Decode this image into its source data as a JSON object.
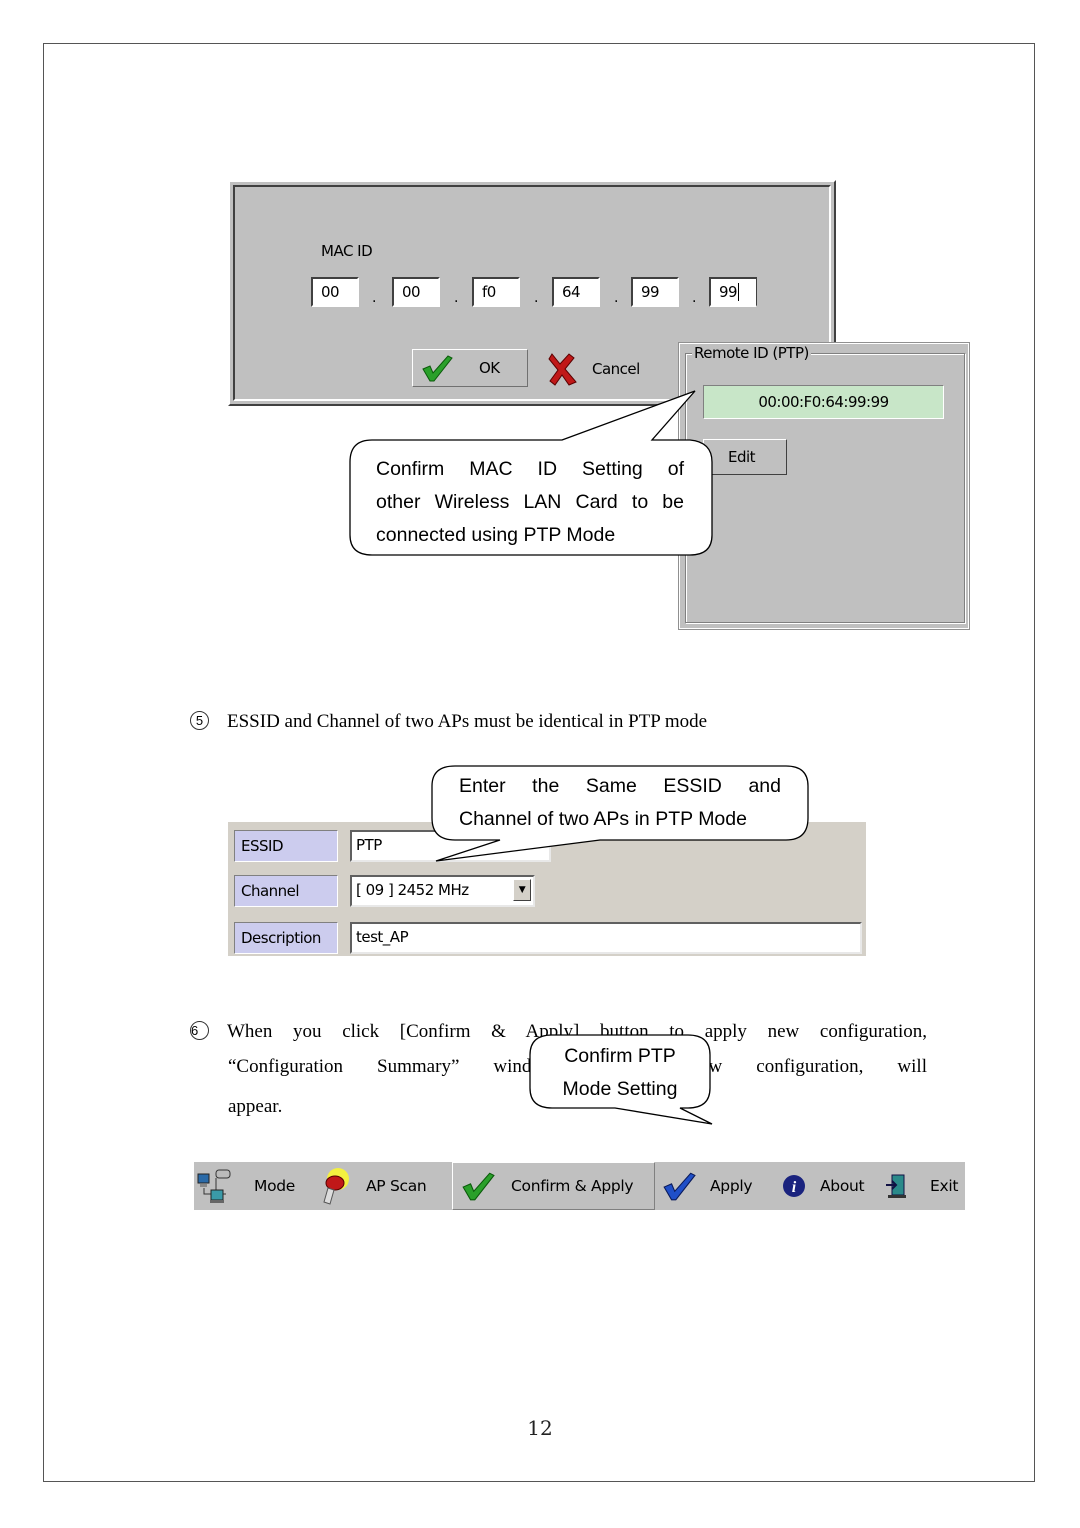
{
  "mac_dialog": {
    "label": "MAC ID",
    "octets": [
      "00",
      "00",
      "f0",
      "64",
      "99",
      "99"
    ],
    "separator": ".",
    "ok_label": "OK",
    "cancel_label": "Cancel"
  },
  "remote_panel": {
    "title": "Remote ID (PTP)",
    "value": "00:00:F0:64:99:99",
    "edit_label": "Edit"
  },
  "callouts": {
    "mac_confirm": {
      "lines": [
        "Confirm MAC ID Setting of",
        "other Wireless LAN Card to be",
        "connected using PTP Mode"
      ]
    },
    "essid_same": {
      "lines": [
        "Enter the Same ESSID and",
        "Channel of two APs in PTP Mode"
      ]
    },
    "confirm_ptp": {
      "lines": [
        "Confirm PTP",
        "Mode Setting"
      ]
    }
  },
  "steps": {
    "step5": {
      "number": "5",
      "text": "ESSID and Channel of two APs must be identical in PTP mode"
    },
    "step6": {
      "number": "6",
      "line1": "When you click [Confirm & Apply] button to apply new configuration,",
      "line2": "“Configuration Summary” window, showing new configuration, will",
      "line3": "appear."
    }
  },
  "form": {
    "essid": {
      "label": "ESSID",
      "value": "PTP"
    },
    "channel": {
      "label": "Channel",
      "value": "[ 09 ] 2452 MHz"
    },
    "description": {
      "label": "Description",
      "value": "test_AP"
    }
  },
  "toolbar": {
    "items": [
      {
        "label": "Mode",
        "icon": "network-icon"
      },
      {
        "label": "AP Scan",
        "icon": "scan-torch-icon"
      },
      {
        "label": "Confirm & Apply",
        "icon": "green-check-icon"
      },
      {
        "label": "Apply",
        "icon": "blue-check-icon"
      },
      {
        "label": "About",
        "icon": "info-icon"
      },
      {
        "label": "Exit",
        "icon": "exit-door-icon"
      }
    ]
  },
  "page_number": "12",
  "colors": {
    "dialog_gray": "#c0c0c0",
    "remote_value_bg": "#c8e6c8",
    "form_label_bg": "#ccccee",
    "ok_check": "#2aa02a",
    "cancel_x": "#c01818",
    "apply_check": "#1f4fc8"
  }
}
